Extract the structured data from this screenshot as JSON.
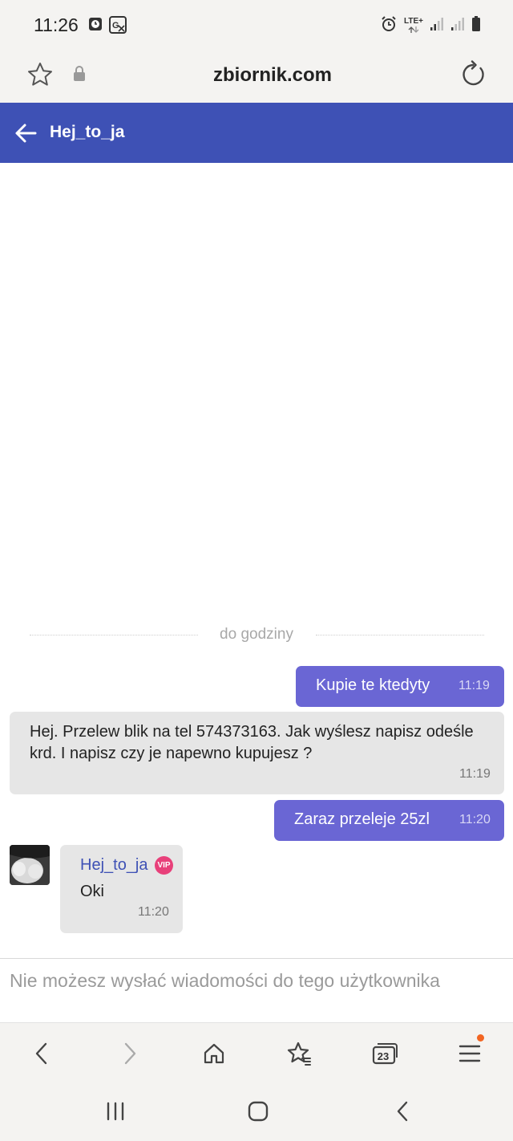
{
  "status_bar": {
    "time": "11:26",
    "network_label": "LTE+",
    "icons": [
      "clock-app-icon",
      "translate-icon",
      "alarm-icon",
      "signal-icon",
      "signal-icon",
      "battery-icon"
    ]
  },
  "browser": {
    "url": "zbiornik.com",
    "icons": [
      "star-icon",
      "lock-icon",
      "reload-icon"
    ]
  },
  "header": {
    "title": "Hej_to_ja",
    "accent_color": "#3e51b5"
  },
  "chat": {
    "divider_label": "do godziny",
    "messages": [
      {
        "direction": "out",
        "text": "Kupie te ktedyty",
        "time": "11:19"
      },
      {
        "direction": "in",
        "text": "Hej. Przelew blik na tel 574373163. Jak wyślesz napisz odeśle krd. I napisz czy je napewno kupujesz ?",
        "time": "11:19"
      },
      {
        "direction": "out",
        "text": "Zaraz przeleje 25zl",
        "time": "11:20"
      },
      {
        "direction": "in",
        "sender": "Hej_to_ja",
        "badge": "VIP",
        "text": "Oki",
        "time": "11:20"
      }
    ],
    "outgoing_color": "#6a66d4",
    "incoming_color": "#e6e6e6"
  },
  "composer": {
    "disabled_text": "Nie możesz wysłać wiadomości do tego użytkownika"
  },
  "bottom_nav": {
    "tabs_count": "23",
    "items": [
      "back-icon",
      "forward-icon",
      "home-icon",
      "bookmarks-icon",
      "tabs-icon",
      "menu-icon"
    ]
  },
  "system_nav": {
    "items": [
      "recents-icon",
      "home-button-icon",
      "system-back-icon"
    ]
  }
}
